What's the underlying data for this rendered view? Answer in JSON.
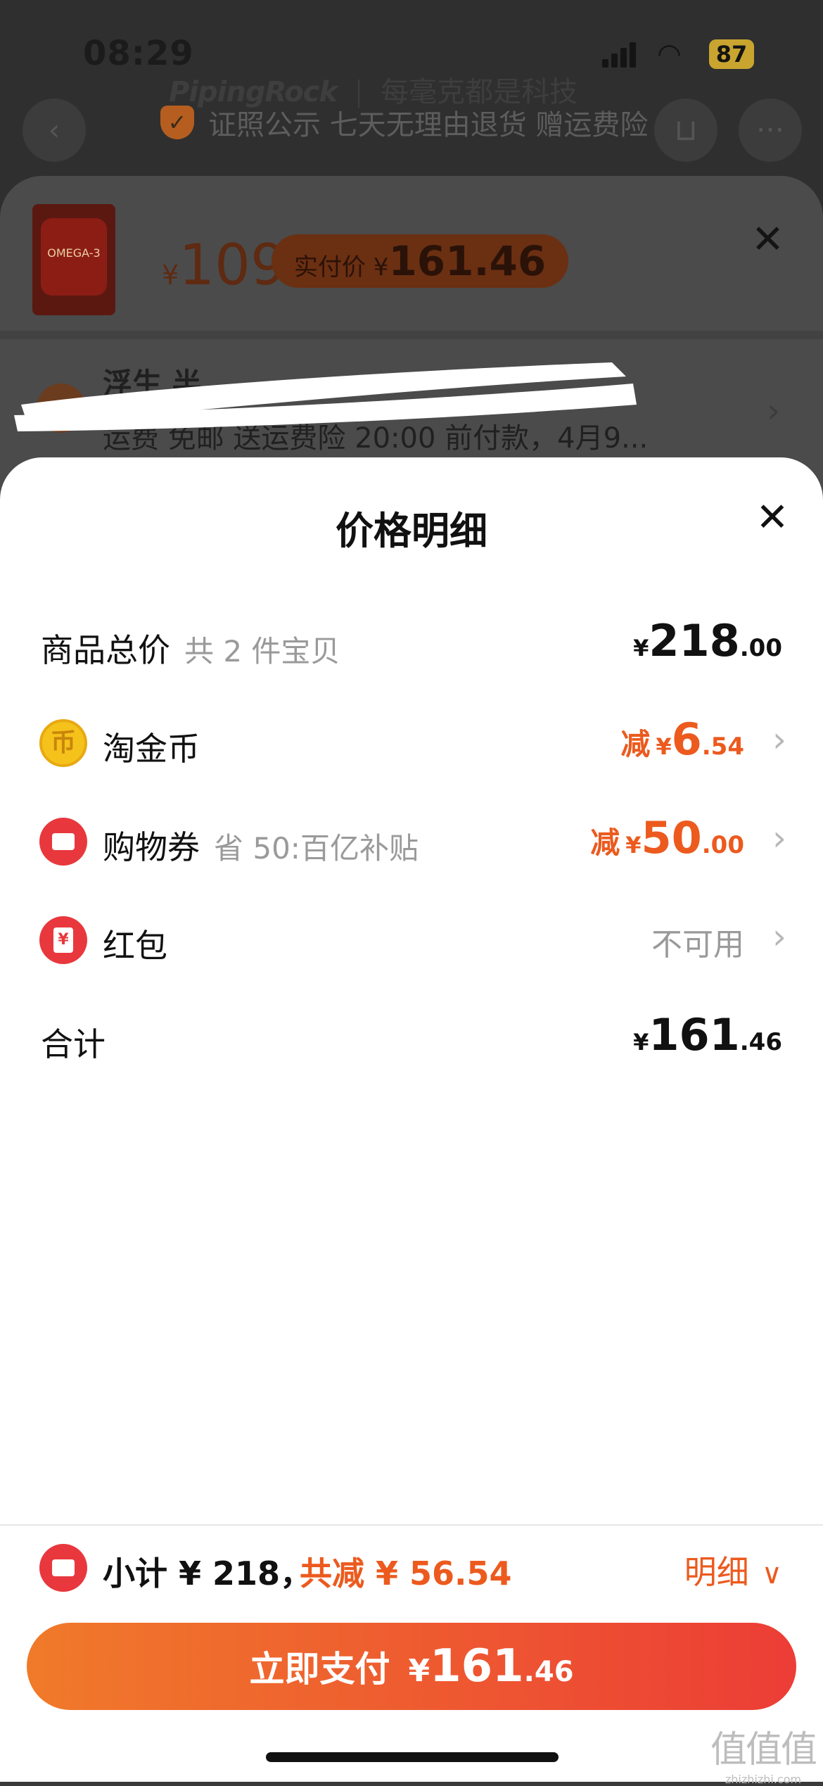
{
  "status_bar": {
    "time": "08:29",
    "battery": "87"
  },
  "background_page": {
    "brand_name": "PipingRock",
    "brand_slogan": "每毫克都是科技",
    "guarantee": "证照公示 七天无理由退货 赠运费险"
  },
  "product_sheet": {
    "thumbnail_label": "OMEGA-3",
    "price_yen": "¥",
    "price": "109",
    "paid_label": "实付价",
    "paid_yen": "¥",
    "paid_price": "161.46",
    "store_name": "浮生 半",
    "shipping": "运费 免邮  送运费险  20:00 前付款，4月9..."
  },
  "price_detail": {
    "title": "价格明细",
    "rows": [
      {
        "label": "商品总价",
        "sub": "共 2 件宝贝",
        "prefix": "",
        "yen": "¥",
        "int": "218",
        "dec": ".00"
      },
      {
        "label": "淘金币",
        "sub": "",
        "prefix": "减",
        "yen": "¥",
        "int": "6",
        "dec": ".54"
      },
      {
        "label": "购物券",
        "sub": "省 50:百亿补贴",
        "prefix": "减",
        "yen": "¥",
        "int": "50",
        "dec": ".00"
      },
      {
        "label": "红包",
        "sub": "",
        "value_text": "不可用"
      },
      {
        "label": "合计",
        "sub": "",
        "prefix": "",
        "yen": "¥",
        "int": "161",
        "dec": ".46"
      }
    ]
  },
  "footer": {
    "subtotal": "小计 ¥ 218，",
    "total_reduce": "共减 ¥ 56.54",
    "detail_label": "明细",
    "pay_label": "立即支付",
    "pay_yen": "¥",
    "pay_int": "161",
    "pay_dec": ".46"
  },
  "watermark": {
    "main": "值值值",
    "sub": "zhizhizhi.com"
  },
  "colors": {
    "accent": "#ec5a1e",
    "coupon_red": "#e8383d",
    "coin_gold": "#f5c21b",
    "pay_start": "#f07a2a",
    "pay_end": "#ec3d36"
  }
}
